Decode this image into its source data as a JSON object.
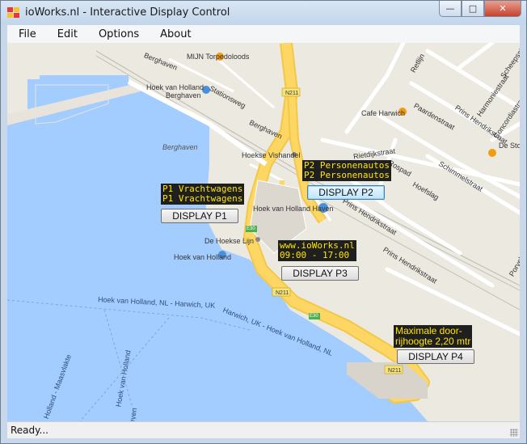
{
  "window": {
    "title": "ioWorks.nl - Interactive Display Control"
  },
  "menu": {
    "items": [
      "File",
      "Edit",
      "Options",
      "About"
    ]
  },
  "status": {
    "text": "Ready..."
  },
  "displays": [
    {
      "id": "p1",
      "lines": [
        "P1 Vrachtwagens",
        "P1 Vrachtwagens"
      ],
      "button": "DISPLAY P1"
    },
    {
      "id": "p2",
      "lines": [
        "P2 Personenautos",
        "P2 Personenautos"
      ],
      "button": "DISPLAY P2"
    },
    {
      "id": "p3",
      "lines": [
        "www.ioWorks.nl",
        "09:00 - 17:00"
      ],
      "button": "DISPLAY P3"
    },
    {
      "id": "p4",
      "lines": [
        "Maximale door-",
        "rijhoogte 2,20 mtr"
      ],
      "button": "DISPLAY P4"
    }
  ],
  "map_labels": {
    "mijn": "MIJN Torpedoloods",
    "berghaven_road": "Berghaven",
    "stationsweg": "Stationsweg",
    "hvh_berghaven": [
      "Hoek van Holland",
      "Berghaven"
    ],
    "berghaven_water": "Berghaven",
    "berghaven_street": "Berghaven",
    "vishandel": "Hoekse Vishandel",
    "hvh_haven": "Hoek van Holland Haven",
    "hoekse_lijn": "De Hoekse Lijn",
    "hvh": "Hoek van Holland",
    "cafe": "Cafe Harwich",
    "rietdijkstraat": "Rietdijkstraat",
    "rospad": "Rospad",
    "paardenstraat": "Paardenstraat",
    "prins_hendrikstraat": "Prins Hendrikstraat",
    "prins_hendrikstraat_2": "Prins Hendrikstraat",
    "prins_hendrikstraat_3": "Prins Hendrikstraat",
    "schimmelstraat": "Schimmelstraat",
    "hoefslag": "Hoefslag",
    "harmoniestraat": "Harmoniestraat",
    "concordiastraat": "Concordiastraat",
    "scheepsstraat": "Scheepsstraat",
    "retlijn": "Retlijn",
    "de_store": "De Store",
    "poryeld": "Poryeldstraat",
    "ferry1": "Hoek van Holland, NL - Harwich, UK",
    "ferry2": "Harwich, UK - Hoek van Holland, NL",
    "maasvlakte": "Holland - Maasvlakte",
    "hvh_vert": "Hoek van Holland",
    "even": "even",
    "road_n211": "N211",
    "road_e30": "E30"
  },
  "colors": {
    "water": "#a3ccff",
    "land": "#ece9e1",
    "road": "#fdd663",
    "lcd_bg": "#1f1f1f",
    "lcd_text": "#ffe600"
  }
}
